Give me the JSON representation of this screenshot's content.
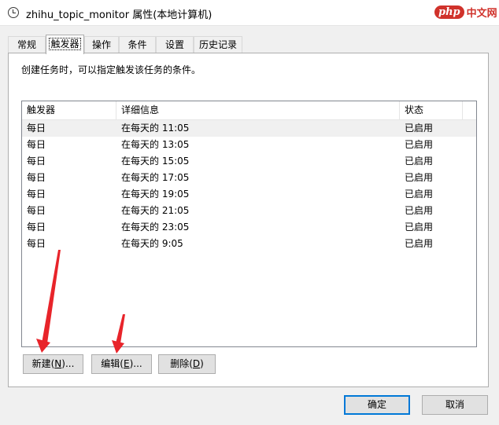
{
  "window": {
    "title": "zhihu_topic_monitor 属性(本地计算机)"
  },
  "watermark": {
    "logo_text": "php",
    "site_text": "中文网"
  },
  "tabs": [
    {
      "label": "常规",
      "active": false
    },
    {
      "label": "触发器",
      "active": true
    },
    {
      "label": "操作",
      "active": false
    },
    {
      "label": "条件",
      "active": false
    },
    {
      "label": "设置",
      "active": false
    },
    {
      "label": "历史记录",
      "active": false
    }
  ],
  "panel": {
    "description": "创建任务时，可以指定触发该任务的条件。"
  },
  "trigger_list": {
    "columns": [
      "触发器",
      "详细信息",
      "状态"
    ],
    "rows": [
      {
        "trigger": "每日",
        "details": "在每天的 11:05",
        "status": "已启用",
        "selected": true
      },
      {
        "trigger": "每日",
        "details": "在每天的 13:05",
        "status": "已启用",
        "selected": false
      },
      {
        "trigger": "每日",
        "details": "在每天的 15:05",
        "status": "已启用",
        "selected": false
      },
      {
        "trigger": "每日",
        "details": "在每天的 17:05",
        "status": "已启用",
        "selected": false
      },
      {
        "trigger": "每日",
        "details": "在每天的 19:05",
        "status": "已启用",
        "selected": false
      },
      {
        "trigger": "每日",
        "details": "在每天的 21:05",
        "status": "已启用",
        "selected": false
      },
      {
        "trigger": "每日",
        "details": "在每天的 23:05",
        "status": "已启用",
        "selected": false
      },
      {
        "trigger": "每日",
        "details": "在每天的 9:05",
        "status": "已启用",
        "selected": false
      }
    ]
  },
  "buttons": {
    "new_label": "新建(",
    "new_mnemonic": "N",
    "new_suffix": ")...",
    "edit_label": "编辑(",
    "edit_mnemonic": "E",
    "edit_suffix": ")...",
    "delete_label": "删除(",
    "delete_mnemonic": "D",
    "delete_suffix": ")",
    "ok_label": "确定",
    "cancel_label": "取消"
  },
  "colors": {
    "annotation_arrow": "#e8242a",
    "default_button_border": "#0078d7"
  }
}
